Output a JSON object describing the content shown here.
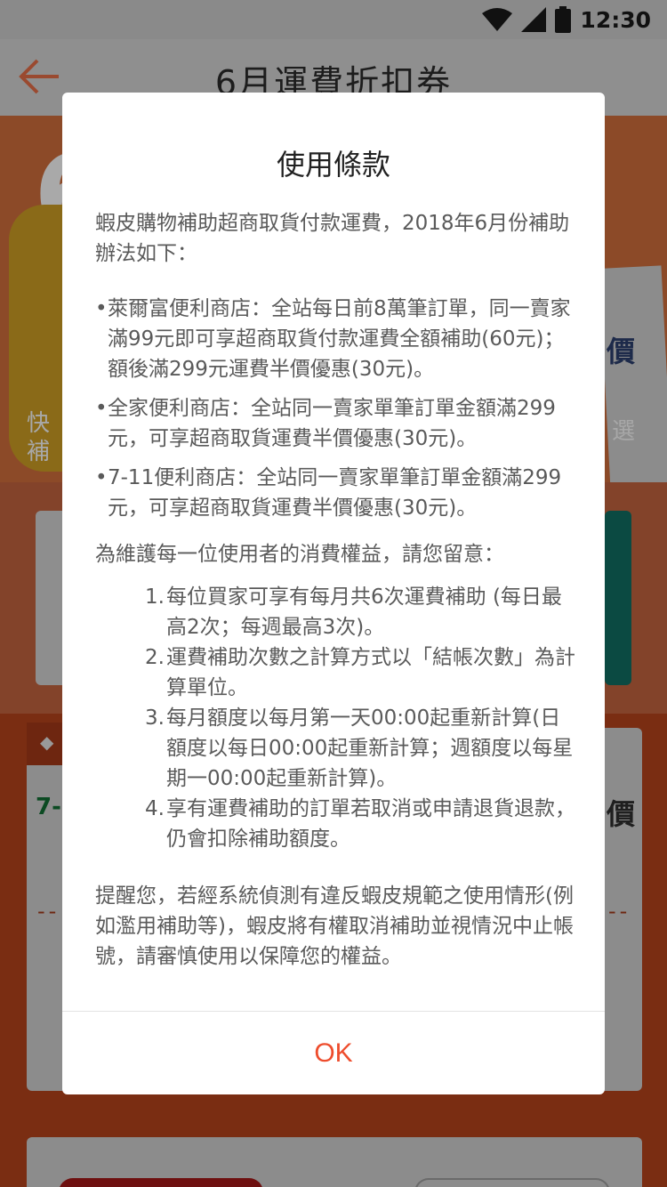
{
  "status_bar": {
    "time": "12:30",
    "icons": [
      "wifi-icon",
      "signal-icon",
      "battery-icon"
    ]
  },
  "header": {
    "title": "6月運費折扣券",
    "back_icon": "arrow-left-icon"
  },
  "background": {
    "banner_number": "6",
    "banner_ticket_text": "價",
    "banner_left_text_1": "快",
    "banner_left_text_2": "補",
    "banner_right_text": "選",
    "coupon_tag": "◆",
    "coupon_brand": "7-",
    "coupon_price_char": "價",
    "dash": "--"
  },
  "dialog": {
    "title": "使用條款",
    "intro": "蝦皮購物補助超商取貨付款運費，2018年6月份補助辦法如下：",
    "bullets": [
      "萊爾富便利商店：全站每日前8萬筆訂單，同一賣家滿99元即可享超商取貨付款運費全額補助(60元)；額後滿299元運費半價優惠(30元)。",
      "全家便利商店：全站同一賣家單筆訂單金額滿299元，可享超商取貨運費半價優惠(30元)。",
      "7-11便利商店：全站同一賣家單筆訂單金額滿299元，可享超商取貨運費半價優惠(30元)。"
    ],
    "bullet_marker": "•",
    "notice": "為維護每一位使用者的消費權益，請您留意：",
    "rules": [
      {
        "num": "1.",
        "text": "每位買家可享有每月共6次運費補助 (每日最高2次；每週最高3次)。"
      },
      {
        "num": "2.",
        "text": "運費補助次數之計算方式以「結帳次數」為計算單位。"
      },
      {
        "num": "3.",
        "text": "每月額度以每月第一天00:00起重新計算(日額度以每日00:00起重新計算；週額度以每星期一00:00起重新計算)。"
      },
      {
        "num": "4.",
        "text": "享有運費補助的訂單若取消或申請退貨退款，仍會扣除補助額度。"
      }
    ],
    "reminder": "提醒您，若經系統偵測有違反蝦皮規範之使用情形(例如濫用補助等)，蝦皮將有權取消補助並視情況中止帳號，請審慎使用以保障您的權益。",
    "ok_label": "OK"
  },
  "colors": {
    "accent": "#ee4d2d",
    "dialog_bg": "#ffffff",
    "text": "#5a5a5a",
    "title": "#222222"
  }
}
